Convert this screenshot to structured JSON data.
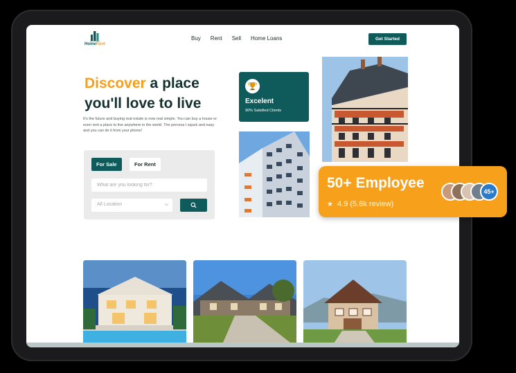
{
  "brand": {
    "logo_text_main": "Home",
    "logo_text_accent": "Rent"
  },
  "nav": {
    "items": [
      {
        "label": "Buy"
      },
      {
        "label": "Rent"
      },
      {
        "label": "Sell"
      },
      {
        "label": "Home Loans"
      }
    ],
    "cta_label": "Get Started"
  },
  "hero": {
    "title_accent": "Discover",
    "title_rest_line1": " a place",
    "title_line2": "you'll love to live",
    "description": "It's the future and buying real estate is now real simple. You can buy a house or even rent a place to live anywhere in the world. The porcess I squck and easy and you can do it from your phone!"
  },
  "search": {
    "tab_sale": "For Sale",
    "tab_rent": "For Rent",
    "placeholder": "What are you looking for?",
    "location_value": "All Location",
    "search_icon": "search-icon"
  },
  "stat_card": {
    "title": "Excelent",
    "subtitle": "90% Satisfied Clients",
    "icon": "trophy-icon"
  },
  "badge": {
    "title": "50+ Employee",
    "rating": "4.9 (5.8k review)",
    "avatar_count": "45+"
  },
  "colors": {
    "brand_teal": "#0f5a5a",
    "accent_orange": "#f5a01b"
  }
}
